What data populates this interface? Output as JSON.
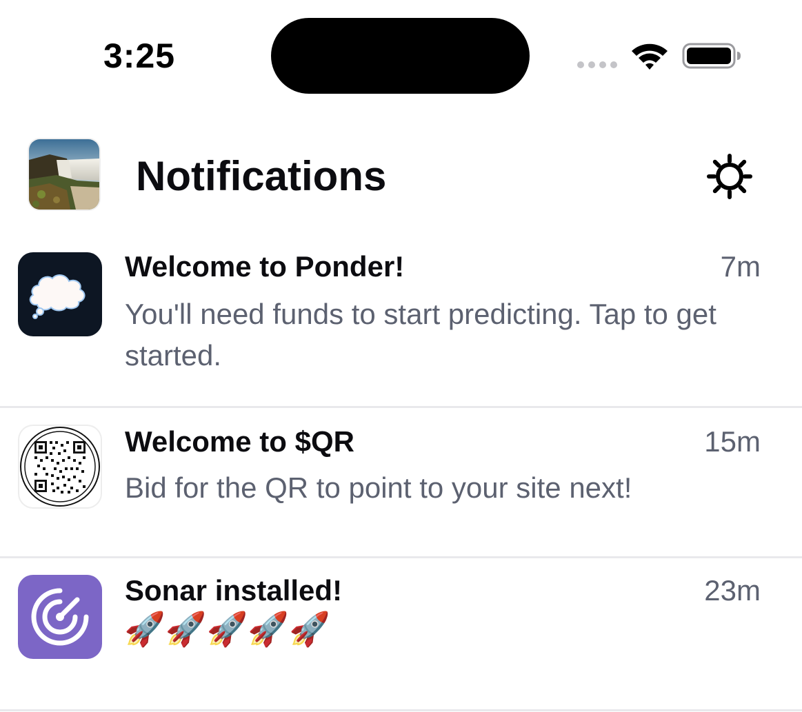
{
  "status_bar": {
    "time": "3:25",
    "signal_icon": "signal-dots-icon",
    "wifi_icon": "wifi-icon",
    "battery_icon": "battery-full-icon"
  },
  "header": {
    "title": "Notifications",
    "avatar": "waterfall-landscape-avatar",
    "settings_icon": "gear-icon"
  },
  "notifications": [
    {
      "app_icon": "thought-cloud-icon",
      "title": "Welcome to Ponder!",
      "time": "7m",
      "body": "You'll need funds to start predicting. Tap to get started."
    },
    {
      "app_icon": "qr-code-icon",
      "title": "Welcome to $QR",
      "time": "15m",
      "body": "Bid for the QR to point to your site next!"
    },
    {
      "app_icon": "radar-icon",
      "title": "Sonar installed!",
      "time": "23m",
      "body": "🚀🚀🚀🚀🚀"
    }
  ],
  "colors": {
    "title_text": "#0c0c10",
    "muted_text": "#5c6170",
    "divider": "#e9e9ec",
    "ponder_bg": "#0d1623",
    "sonar_bg": "#7c66c6"
  }
}
